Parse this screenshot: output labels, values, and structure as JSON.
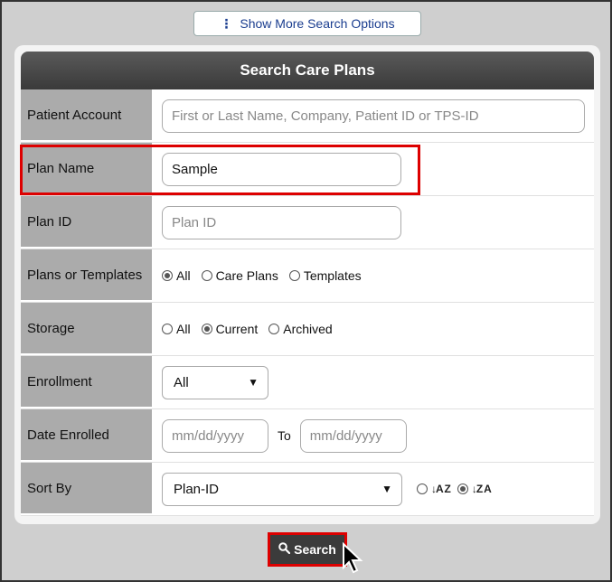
{
  "top_button": {
    "label": "Show More Search Options",
    "icon": "vertical-ellipsis-icon"
  },
  "panel": {
    "title": "Search Care Plans"
  },
  "fields": {
    "patient_account": {
      "label": "Patient Account",
      "placeholder": "First or Last Name, Company, Patient ID or TPS-ID",
      "value": ""
    },
    "plan_name": {
      "label": "Plan Name",
      "value": "Sample"
    },
    "plan_id": {
      "label": "Plan ID",
      "placeholder": "Plan ID",
      "value": ""
    },
    "plans_or_templates": {
      "label": "Plans or Templates",
      "options": [
        "All",
        "Care Plans",
        "Templates"
      ],
      "selected": "All"
    },
    "storage": {
      "label": "Storage",
      "options": [
        "All",
        "Current",
        "Archived"
      ],
      "selected": "Current"
    },
    "enrollment": {
      "label": "Enrollment",
      "value": "All"
    },
    "date_enrolled": {
      "label": "Date Enrolled",
      "from_placeholder": "mm/dd/yyyy",
      "to_label": "To",
      "to_placeholder": "mm/dd/yyyy"
    },
    "sort_by": {
      "label": "Sort By",
      "value": "Plan-ID",
      "asc_icon": "↓A Z",
      "desc_icon": "↓Z A",
      "selected_order": "desc"
    }
  },
  "search_button": {
    "label": "Search",
    "icon": "search-icon"
  }
}
